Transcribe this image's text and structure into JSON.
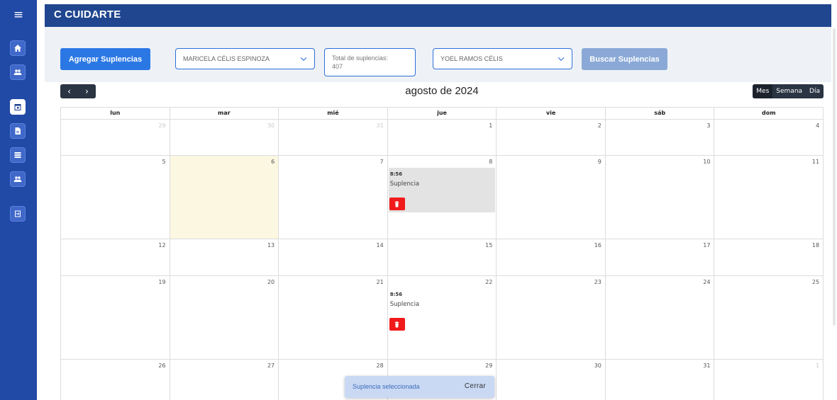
{
  "app": {
    "title": "C CUIDARTE"
  },
  "sidebar": {
    "items": [
      {
        "name": "home",
        "icon": "home-icon"
      },
      {
        "name": "users",
        "icon": "users-icon"
      },
      {
        "name": "calendar",
        "icon": "calendar-icon",
        "active": true
      },
      {
        "name": "document",
        "icon": "document-icon"
      },
      {
        "name": "list",
        "icon": "list-icon"
      },
      {
        "name": "group",
        "icon": "users-icon"
      },
      {
        "name": "logout",
        "icon": "logout-icon"
      }
    ]
  },
  "controls": {
    "add_label": "Agregar Suplencias",
    "select_worker": "MARICELA CÉLIS ESPINOZA",
    "total_label": "Total de suplencias:",
    "total_value": "407",
    "select_replacement": "YOEL RAMOS CÉLIS",
    "search_label": "Buscar Suplencias"
  },
  "calendar": {
    "title": "agosto de 2024",
    "nav_prev": "‹",
    "nav_next": "›",
    "views": [
      "Mes",
      "Semana",
      "Día"
    ],
    "active_view": "Mes",
    "weekdays": [
      "lun",
      "mar",
      "mié",
      "jue",
      "vie",
      "sáb",
      "dom"
    ],
    "weeks": [
      [
        "29",
        "30",
        "31",
        "1",
        "2",
        "3",
        "4"
      ],
      [
        "5",
        "6",
        "7",
        "8",
        "9",
        "10",
        "11"
      ],
      [
        "12",
        "13",
        "14",
        "15",
        "16",
        "17",
        "18"
      ],
      [
        "19",
        "20",
        "21",
        "22",
        "23",
        "24",
        "25"
      ],
      [
        "26",
        "27",
        "28",
        "29",
        "30",
        "31",
        "1"
      ]
    ],
    "events": [
      {
        "time": "8:56",
        "title": "Suplencia"
      },
      {
        "time": "8:56",
        "title": "Suplencia"
      }
    ]
  },
  "snackbar": {
    "message": "Suplencia seleccionada",
    "close_label": "Cerrar"
  },
  "colors": {
    "primary": "#2149a6",
    "button": "#2b78e4",
    "delete": "#f11a1a",
    "today": "#fcf7e1"
  }
}
